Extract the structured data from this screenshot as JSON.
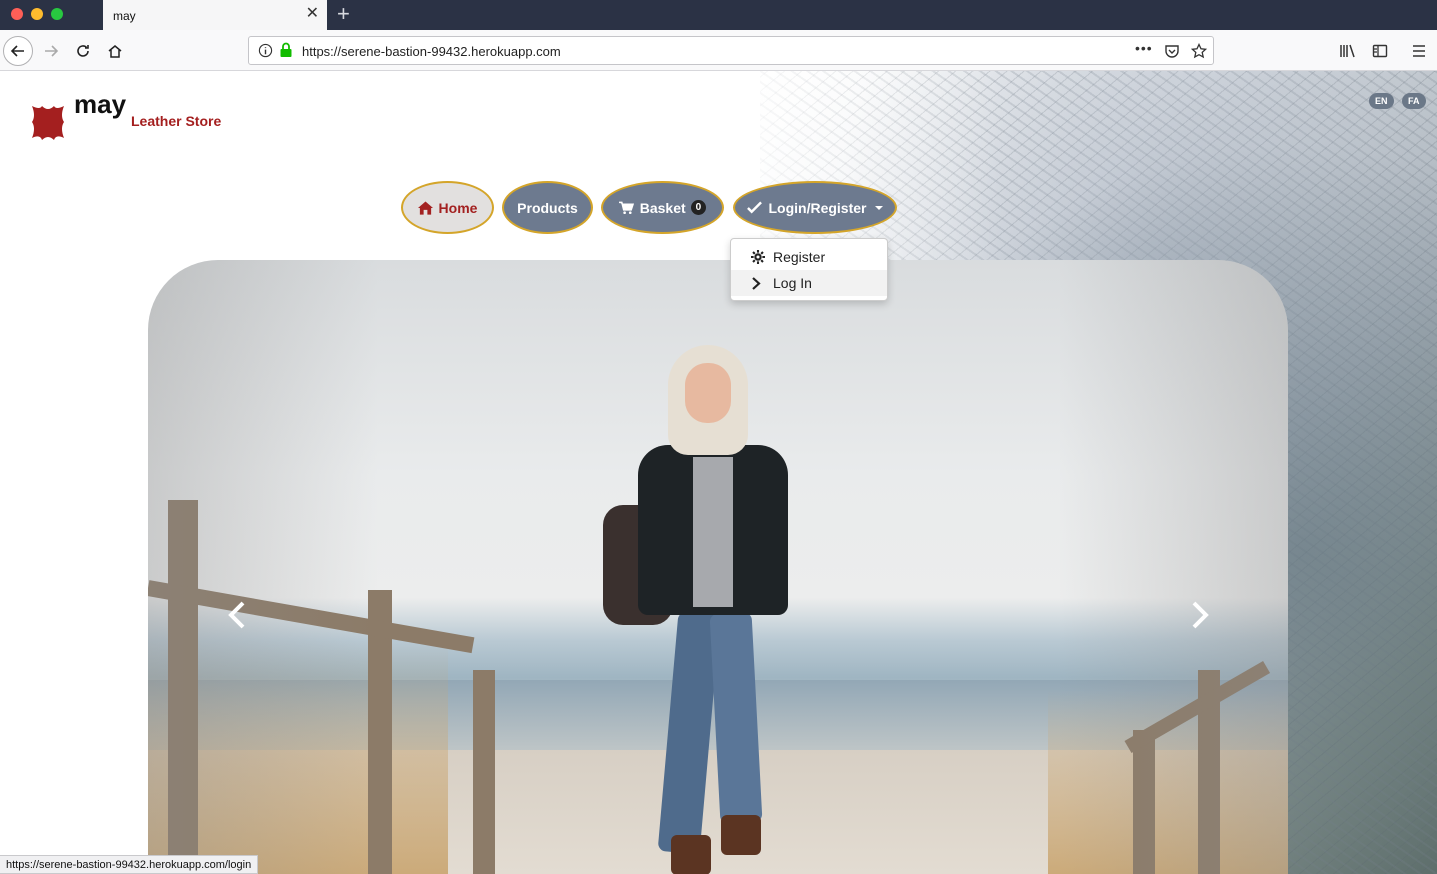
{
  "browser": {
    "tab_title": "may",
    "tab_close": "✕",
    "new_tab": "+",
    "url": "https://serene-bastion-99432.herokuapp.com",
    "status_url": "https://serene-bastion-99432.herokuapp.com/login",
    "page_actions": "•••"
  },
  "header": {
    "brand_name": "may",
    "brand_sub": "Leather Store",
    "brand_color": "#a41f1f",
    "languages": [
      "EN",
      "FA"
    ]
  },
  "nav": {
    "home": "Home",
    "products": "Products",
    "basket": "Basket",
    "basket_count": "0",
    "login": "Login/Register"
  },
  "dropdown": {
    "items": [
      {
        "label": "Register",
        "icon": "gear-icon"
      },
      {
        "label": "Log In",
        "icon": "chevron-right-icon"
      }
    ]
  },
  "colors": {
    "nav_bg": "#6d7a8f",
    "nav_border": "#d4a52a",
    "home_text": "#a32121"
  }
}
